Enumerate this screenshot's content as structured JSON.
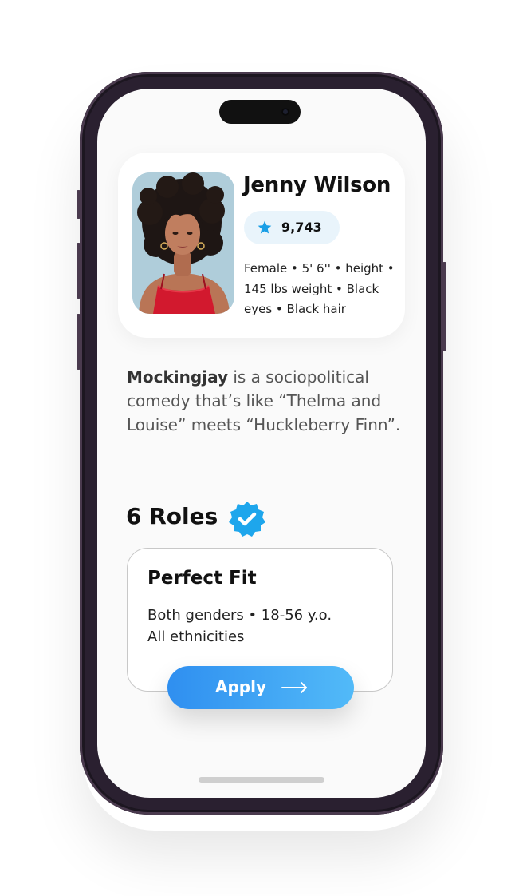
{
  "profile": {
    "name": "Jenny Wilson",
    "rating": "9,743",
    "description": "Female • 5' 6'' • height • 145 lbs weight • Black eyes • Black hair",
    "avatar_icon": "person-photo",
    "star_icon": "star-icon"
  },
  "tagline": {
    "title_bold": "Mockingjay",
    "text": " is a sociopolitical comedy that’s like “Thelma and Louise” meets “Huckleberry Finn”."
  },
  "roles": {
    "title": "6 Roles",
    "verified_icon": "verified-badge-icon",
    "card": {
      "title": "Perfect Fit",
      "line1": "Both genders • 18-56 y.o.",
      "line2": "All ethnicities"
    },
    "apply_label": "Apply",
    "arrow_icon": "arrow-right-icon"
  },
  "colors": {
    "accent_start": "#2f8ff0",
    "accent_end": "#52baf8",
    "star": "#1a9fe6",
    "rating_pill_bg": "#e9f4fb",
    "phone_frame": "#2a2030"
  }
}
